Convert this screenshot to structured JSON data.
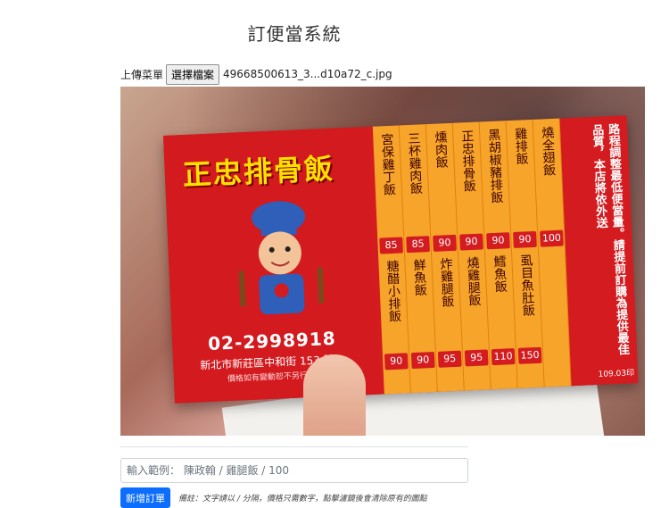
{
  "page": {
    "title": "訂便當系統"
  },
  "upload": {
    "label": "上傳菜單",
    "button_label": "選擇檔案",
    "file_name": "49668500613_3...d10a72_c.jpg"
  },
  "photo": {
    "card": {
      "logo_text": "正忠排骨飯",
      "phone": "02-2998918",
      "address": "新北市新莊區中和街 153 號",
      "note": "價格如有變動恕不另行通知",
      "promo": "路程調整最低便當量。請提前訂購為提供最佳品質，本店將依外送",
      "date": "109.03印",
      "menu": [
        {
          "name": "宮保雞丁飯",
          "price": "85",
          "name2": "糖醋小排飯",
          "price2": "90"
        },
        {
          "name": "三杯雞肉飯",
          "price": "85",
          "name2": "鮮魚飯",
          "price2": "90"
        },
        {
          "name": "燻肉飯",
          "price": "90",
          "name2": "炸雞腿飯",
          "price2": "95"
        },
        {
          "name": "正忠排骨飯",
          "price": "90",
          "name2": "燒雞腿飯",
          "price2": "95"
        },
        {
          "name": "黑胡椒豬排飯",
          "price": "90",
          "name2": "鱈魚飯",
          "price2": "110"
        },
        {
          "name": "雞排飯",
          "price": "90",
          "name2": "虱目魚肚飯",
          "price2": "150"
        },
        {
          "name": "燒全翅飯",
          "price": "100",
          "name2": "",
          "price2": ""
        }
      ]
    }
  },
  "order": {
    "placeholder": "輸入範例： 陳政翰 / 雞腿飯 / 100",
    "add_button_label": "新增訂單",
    "remark": "備註：文字請以 / 分隔，價格只需數字，點擊濾鏡後會清除原有的圖點"
  }
}
